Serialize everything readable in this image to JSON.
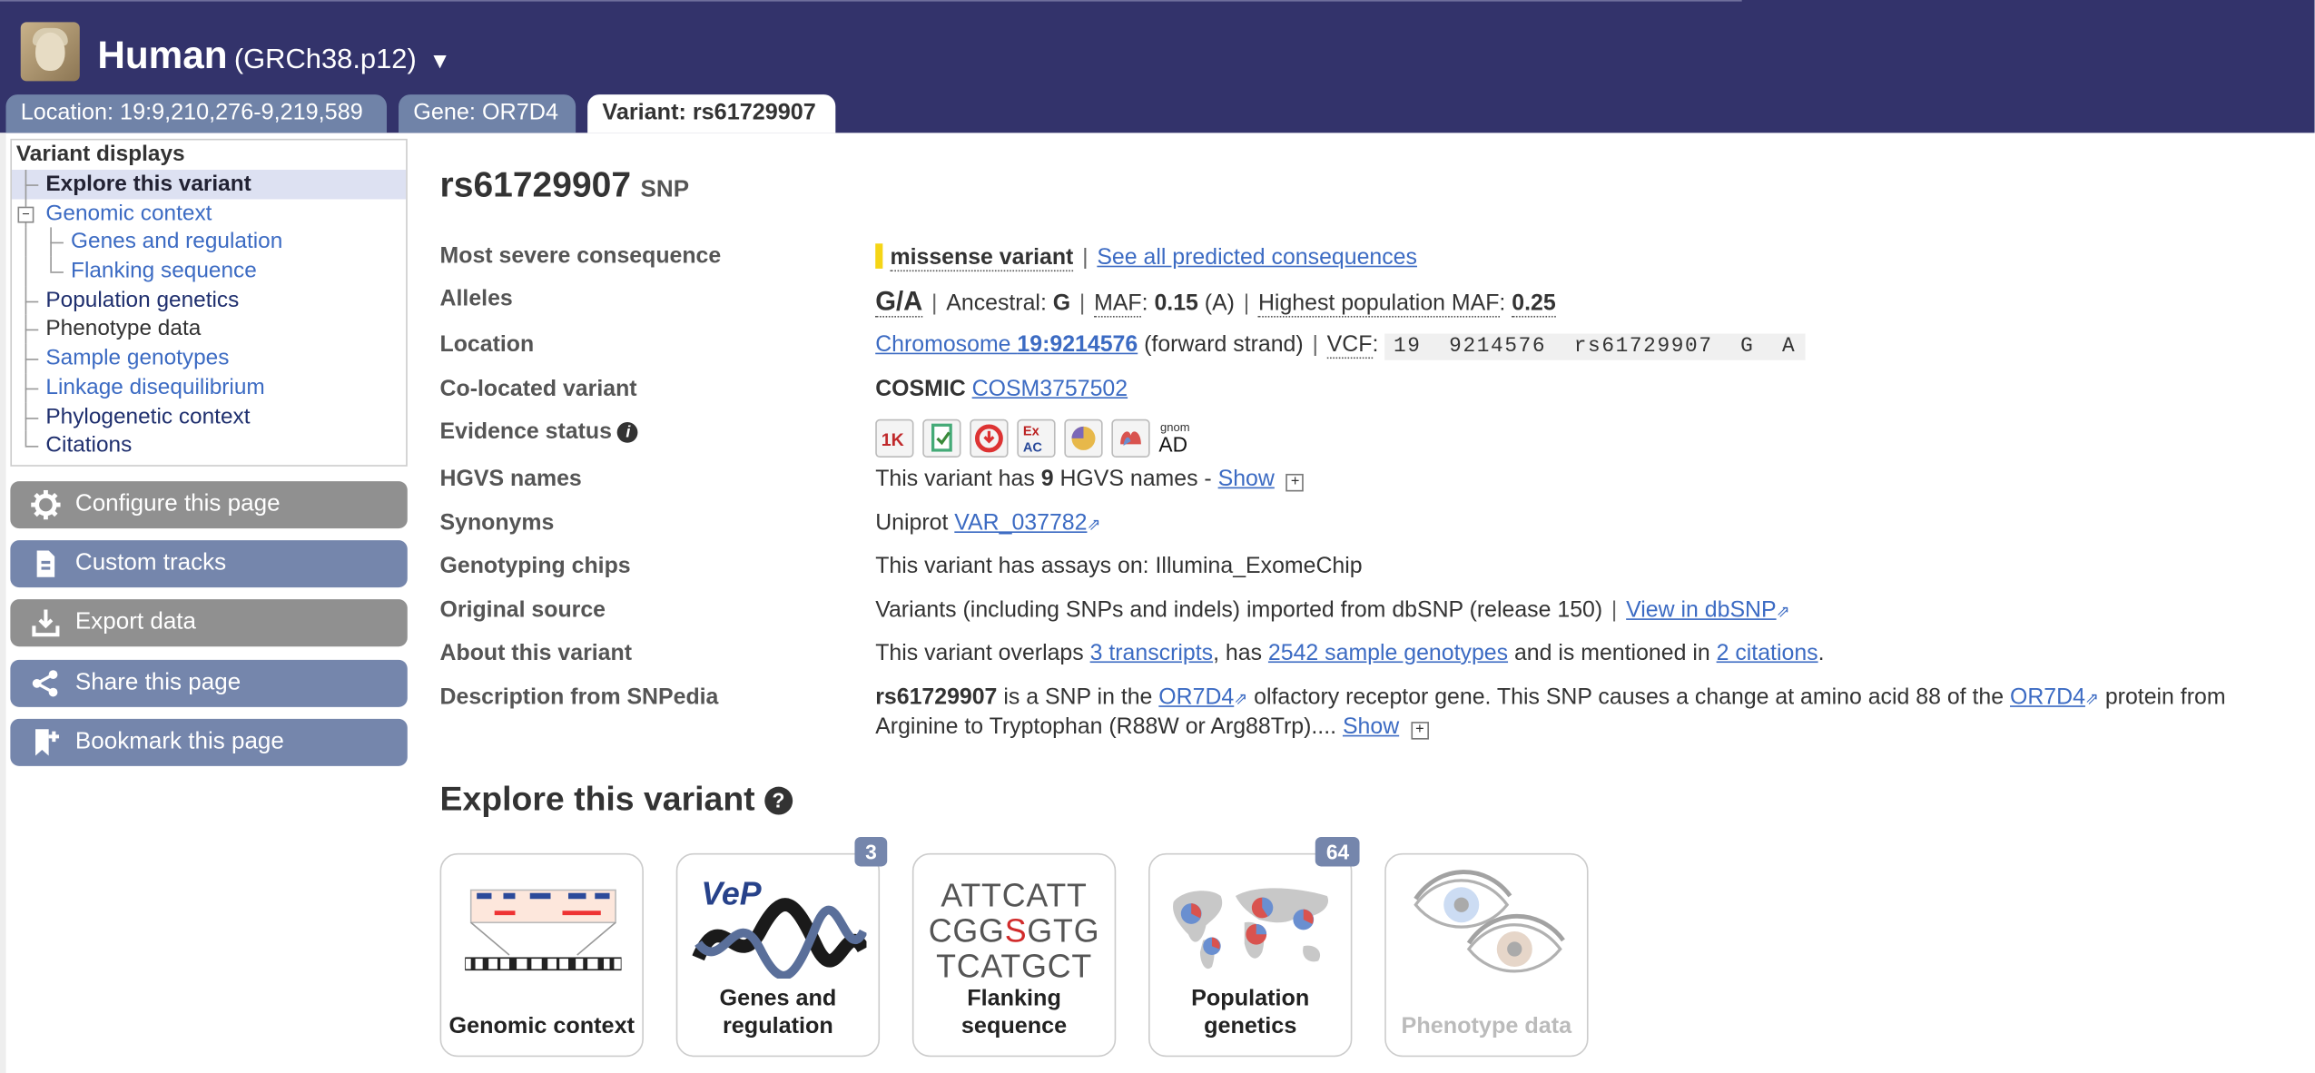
{
  "header": {
    "species": "Human",
    "assembly": "(GRCh38.p12)",
    "dropdown_glyph": "▼",
    "tabs": [
      {
        "label": "Location: 19:9,210,276-9,219,589"
      },
      {
        "label": "Gene: OR7D4"
      },
      {
        "label": "Variant: rs61729907"
      }
    ]
  },
  "sidebar": {
    "heading": "Variant displays",
    "items": [
      {
        "label": "Explore this variant"
      },
      {
        "label": "Genomic context"
      },
      {
        "label": "Genes and regulation"
      },
      {
        "label": "Flanking sequence"
      },
      {
        "label": "Population genetics"
      },
      {
        "label": "Phenotype data"
      },
      {
        "label": "Sample genotypes"
      },
      {
        "label": "Linkage disequilibrium"
      },
      {
        "label": "Phylogenetic context"
      },
      {
        "label": "Citations"
      }
    ],
    "buttons": [
      {
        "label": "Configure this page",
        "icon": "gear-icon"
      },
      {
        "label": "Custom tracks",
        "icon": "custom-tracks-icon"
      },
      {
        "label": "Export data",
        "icon": "download-icon"
      },
      {
        "label": "Share this page",
        "icon": "share-icon"
      },
      {
        "label": "Bookmark this page",
        "icon": "bookmark-icon"
      }
    ]
  },
  "variant": {
    "id": "rs61729907",
    "type": "SNP"
  },
  "summary": {
    "consequence_label": "Most severe consequence",
    "consequence_value": "missense variant",
    "consequence_link": "See all predicted consequences",
    "alleles_label": "Alleles",
    "alleles_value": "G/A",
    "ancestral_label": "Ancestral:",
    "ancestral_value": "G",
    "maf_label": "MAF",
    "maf_value": "0.15",
    "maf_allele": "(A)",
    "hpmaf_label": "Highest population MAF",
    "hpmaf_value": "0.25",
    "location_label": "Location",
    "location_link_prefix": "Chromosome ",
    "location_link_value": "19:9214576",
    "location_strand": "(forward strand)",
    "vcf_label": "VCF",
    "vcf_value": "19  9214576  rs61729907  G  A",
    "colocated_label": "Co-located variant",
    "colocated_source": "COSMIC",
    "colocated_link": "COSM3757502",
    "evidence_label": "Evidence status",
    "evidence_icons": [
      "1000-genomes-icon",
      "cited-icon",
      "frequency-icon",
      "exac-icon",
      "phenotype-icon",
      "topmed-icon",
      "gnomad-icon"
    ],
    "exac_text": "Ex AC",
    "gnomad_top": "gnom",
    "gnomad_bottom": "AD",
    "onekg_text": "1K",
    "hgvs_label": "HGVS names",
    "hgvs_prefix": "This variant has ",
    "hgvs_count": "9",
    "hgvs_suffix": " HGVS names - ",
    "show_label": "Show",
    "synonyms_label": "Synonyms",
    "synonyms_source": "Uniprot",
    "synonyms_link": "VAR_037782",
    "chips_label": "Genotyping chips",
    "chips_value": "This variant has assays on: Illumina_ExomeChip",
    "source_label": "Original source",
    "source_value": "Variants (including SNPs and indels) imported from dbSNP (release 150)",
    "source_link": "View in dbSNP",
    "about_label": "About this variant",
    "about_prefix": "This variant overlaps ",
    "about_link1": "3 transcripts",
    "about_mid1": ", has ",
    "about_link2": "2542 sample genotypes",
    "about_mid2": " and is mentioned in ",
    "about_link3": "2 citations",
    "about_end": ".",
    "snpedia_label": "Description from SNPedia",
    "snpedia_id": "rs61729907",
    "snpedia_t1": " is a SNP in the ",
    "snpedia_gene": "OR7D4",
    "snpedia_t2": " olfactory receptor gene. This SNP causes a change at amino acid 88 of the ",
    "snpedia_t3": " protein from",
    "snpedia_line2": "Arginine to Tryptophan (R88W or Arg88Trp).... "
  },
  "explore": {
    "title": "Explore this variant",
    "help_glyph": "?",
    "tiles": [
      {
        "caption": "Genomic context",
        "badge": ""
      },
      {
        "caption": "Genes and regulation",
        "badge": "3"
      },
      {
        "caption": "Flanking sequence",
        "badge": ""
      },
      {
        "caption": "Population genetics",
        "badge": "64"
      },
      {
        "caption": "Phenotype data",
        "badge": ""
      }
    ],
    "flank_lines": [
      "ATTCATT",
      "CGG",
      "S",
      "GTG",
      "TCATGCT"
    ],
    "vep_logo": "VeP"
  },
  "colors": {
    "masthead": "#33336b",
    "tab_inactive": "#7083a8",
    "button_blue": "#7586ac",
    "button_grey": "#909090",
    "link": "#3c6bc3",
    "consequence_bar": "#f5d516"
  }
}
